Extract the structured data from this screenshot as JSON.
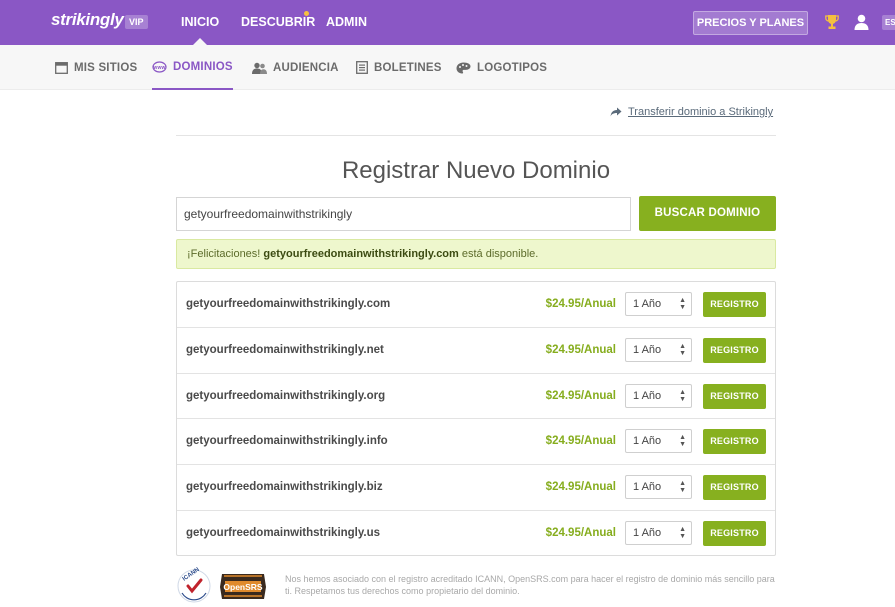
{
  "header": {
    "logo": "strikingly",
    "vip_badge": "VIP",
    "nav": [
      "INICIO",
      "DESCUBRIR",
      "ADMIN"
    ],
    "pricing_button": "PRECIOS Y PLANES",
    "lang": "ES"
  },
  "subnav": {
    "items": [
      {
        "label": "MIS SITIOS",
        "icon": "window-icon"
      },
      {
        "label": "DOMINIOS",
        "icon": "www-icon",
        "active": true
      },
      {
        "label": "AUDIENCIA",
        "icon": "users-icon"
      },
      {
        "label": "BOLETINES",
        "icon": "newsletter-icon"
      },
      {
        "label": "LOGOTIPOS",
        "icon": "palette-icon"
      }
    ]
  },
  "main": {
    "transfer_link": "Transferir dominio a Strikingly",
    "title": "Registrar Nuevo Dominio",
    "search_value": "getyourfreedomainwithstrikingly",
    "search_button": "BUSCAR DOMINIO",
    "alert": {
      "prefix": "¡Felicitaciones! ",
      "domain": "getyourfreedomainwithstrikingly.com",
      "suffix": " está disponible."
    }
  },
  "domains": [
    {
      "name": "getyourfreedomainwithstrikingly.com",
      "price": "$24.95/Anual",
      "years": "1 Año",
      "button": "REGISTRO"
    },
    {
      "name": "getyourfreedomainwithstrikingly.net",
      "price": "$24.95/Anual",
      "years": "1 Año",
      "button": "REGISTRO"
    },
    {
      "name": "getyourfreedomainwithstrikingly.org",
      "price": "$24.95/Anual",
      "years": "1 Año",
      "button": "REGISTRO"
    },
    {
      "name": "getyourfreedomainwithstrikingly.info",
      "price": "$24.95/Anual",
      "years": "1 Año",
      "button": "REGISTRO"
    },
    {
      "name": "getyourfreedomainwithstrikingly.biz",
      "price": "$24.95/Anual",
      "years": "1 Año",
      "button": "REGISTRO"
    },
    {
      "name": "getyourfreedomainwithstrikingly.us",
      "price": "$24.95/Anual",
      "years": "1 Año",
      "button": "REGISTRO"
    }
  ],
  "footer": {
    "disclaimer": "Nos hemos asociado con el registro acreditado ICANN, OpenSRS.com para hacer el registro de dominio más sencillo para ti. Respetamos tus derechos como propietario del dominio.",
    "icann_logo_text": "ICANN Accredited Registrar",
    "opensrs_logo_text": "OpenSRS"
  },
  "colors": {
    "brand_purple": "#8a57c5",
    "accent_green": "#87b01f",
    "alert_bg": "#eef7cd"
  }
}
